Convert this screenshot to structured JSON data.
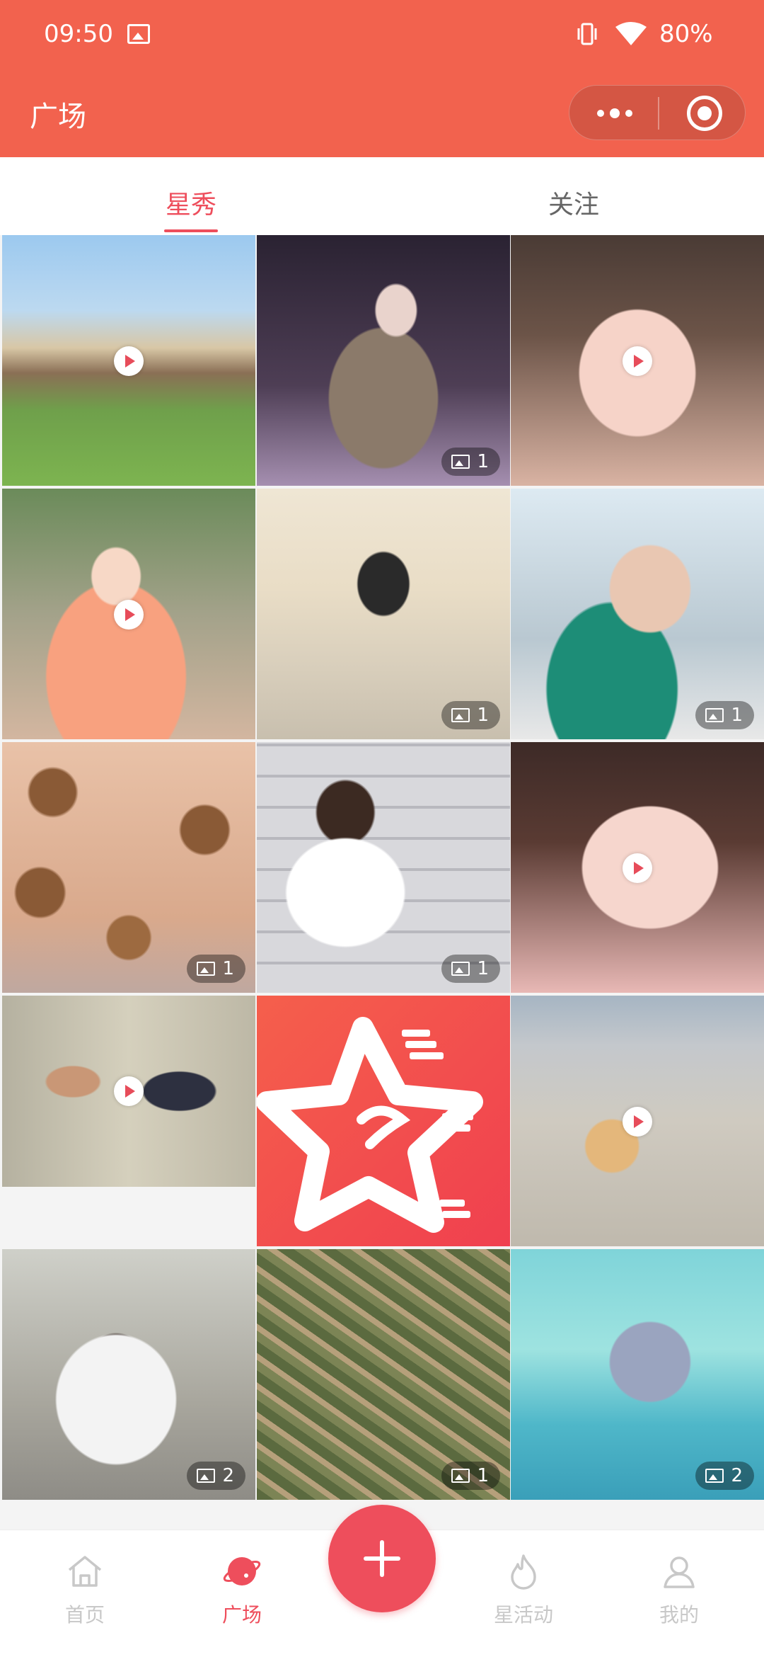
{
  "status_bar": {
    "time": "09:50",
    "battery": "80%"
  },
  "header": {
    "title": "广场"
  },
  "tabs": [
    {
      "label": "星秀",
      "active": true
    },
    {
      "label": "关注",
      "active": false
    }
  ],
  "feed": {
    "tiles": [
      {
        "id": 1,
        "type": "video"
      },
      {
        "id": 2,
        "type": "image",
        "count": "1"
      },
      {
        "id": 3,
        "type": "video"
      },
      {
        "id": 4,
        "type": "video"
      },
      {
        "id": 5,
        "type": "image",
        "count": "1"
      },
      {
        "id": 6,
        "type": "image",
        "count": "1"
      },
      {
        "id": 7,
        "type": "image",
        "count": "1"
      },
      {
        "id": 8,
        "type": "image",
        "count": "1"
      },
      {
        "id": 9,
        "type": "video"
      },
      {
        "id": 10,
        "type": "video"
      },
      {
        "id": 11,
        "type": "logo"
      },
      {
        "id": 12,
        "type": "video"
      },
      {
        "id": 13,
        "type": "image",
        "count": "2"
      },
      {
        "id": 14,
        "type": "image",
        "count": "1"
      },
      {
        "id": 15,
        "type": "image",
        "count": "2"
      }
    ]
  },
  "bottom_nav": {
    "home": "首页",
    "square": "广场",
    "activity": "星活动",
    "mine": "我的"
  },
  "colors": {
    "brand": "#f2624e",
    "accent": "#ee4e5c"
  }
}
